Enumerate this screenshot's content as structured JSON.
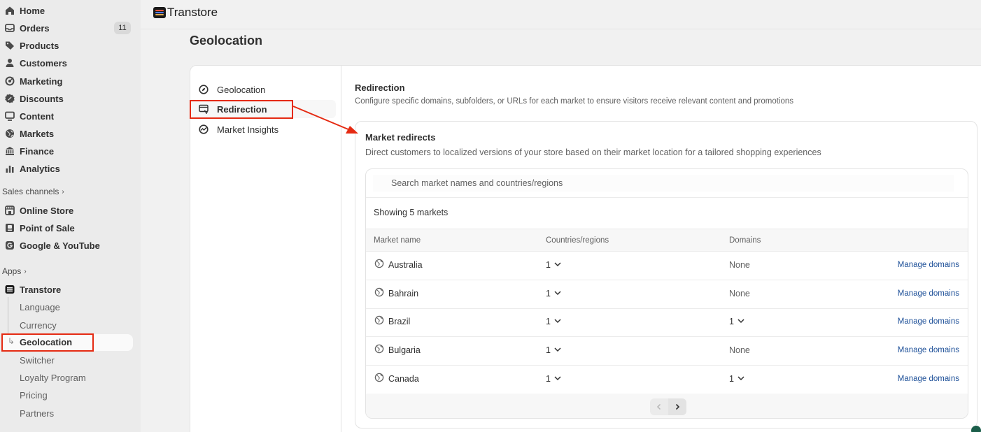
{
  "sidebar": {
    "nav": [
      {
        "label": "Home",
        "icon": "home-icon"
      },
      {
        "label": "Orders",
        "icon": "inbox-icon",
        "badge": "11"
      },
      {
        "label": "Products",
        "icon": "tag-icon"
      },
      {
        "label": "Customers",
        "icon": "person-icon"
      },
      {
        "label": "Marketing",
        "icon": "target-icon"
      },
      {
        "label": "Discounts",
        "icon": "discount-icon"
      },
      {
        "label": "Content",
        "icon": "monitor-icon"
      },
      {
        "label": "Markets",
        "icon": "globe-icon"
      },
      {
        "label": "Finance",
        "icon": "bank-icon"
      },
      {
        "label": "Analytics",
        "icon": "bar-chart-icon"
      }
    ],
    "sales_channels_label": "Sales channels",
    "channels": [
      {
        "label": "Online Store",
        "icon": "store-icon"
      },
      {
        "label": "Point of Sale",
        "icon": "pos-icon"
      },
      {
        "label": "Google & YouTube",
        "icon": "google-icon"
      }
    ],
    "apps_label": "Apps",
    "app_name": "Transtore",
    "app_items": [
      "Language",
      "Currency",
      "Geolocation",
      "Switcher",
      "Loyalty Program",
      "Pricing",
      "Partners"
    ],
    "app_active": "Geolocation"
  },
  "topbar": {
    "app_title": "Transtore"
  },
  "page": {
    "title": "Geolocation"
  },
  "tabs": [
    {
      "label": "Geolocation",
      "icon": "compass-icon"
    },
    {
      "label": "Redirection",
      "icon": "redirect-icon"
    },
    {
      "label": "Market Insights",
      "icon": "insights-icon"
    }
  ],
  "redirection": {
    "title": "Redirection",
    "description": "Configure specific domains, subfolders, or URLs for each market to ensure visitors receive relevant content and promotions"
  },
  "market_redirects": {
    "title": "Market redirects",
    "description": "Direct customers to localized versions of your store based on their market location for a tailored shopping experiences",
    "search_placeholder": "Search market names and countries/regions",
    "showing": "Showing 5 markets",
    "columns": [
      "Market name",
      "Countries/regions",
      "Domains"
    ],
    "rows": [
      {
        "market": "Australia",
        "countries": "1",
        "domains": "None",
        "action": "Manage domains"
      },
      {
        "market": "Bahrain",
        "countries": "1",
        "domains": "None",
        "action": "Manage domains"
      },
      {
        "market": "Brazil",
        "countries": "1",
        "domains": "1",
        "action": "Manage domains"
      },
      {
        "market": "Bulgaria",
        "countries": "1",
        "domains": "None",
        "action": "Manage domains"
      },
      {
        "market": "Canada",
        "countries": "1",
        "domains": "1",
        "action": "Manage domains"
      }
    ]
  },
  "colors": {
    "accent": "#e52a12",
    "link": "#1f5199"
  }
}
